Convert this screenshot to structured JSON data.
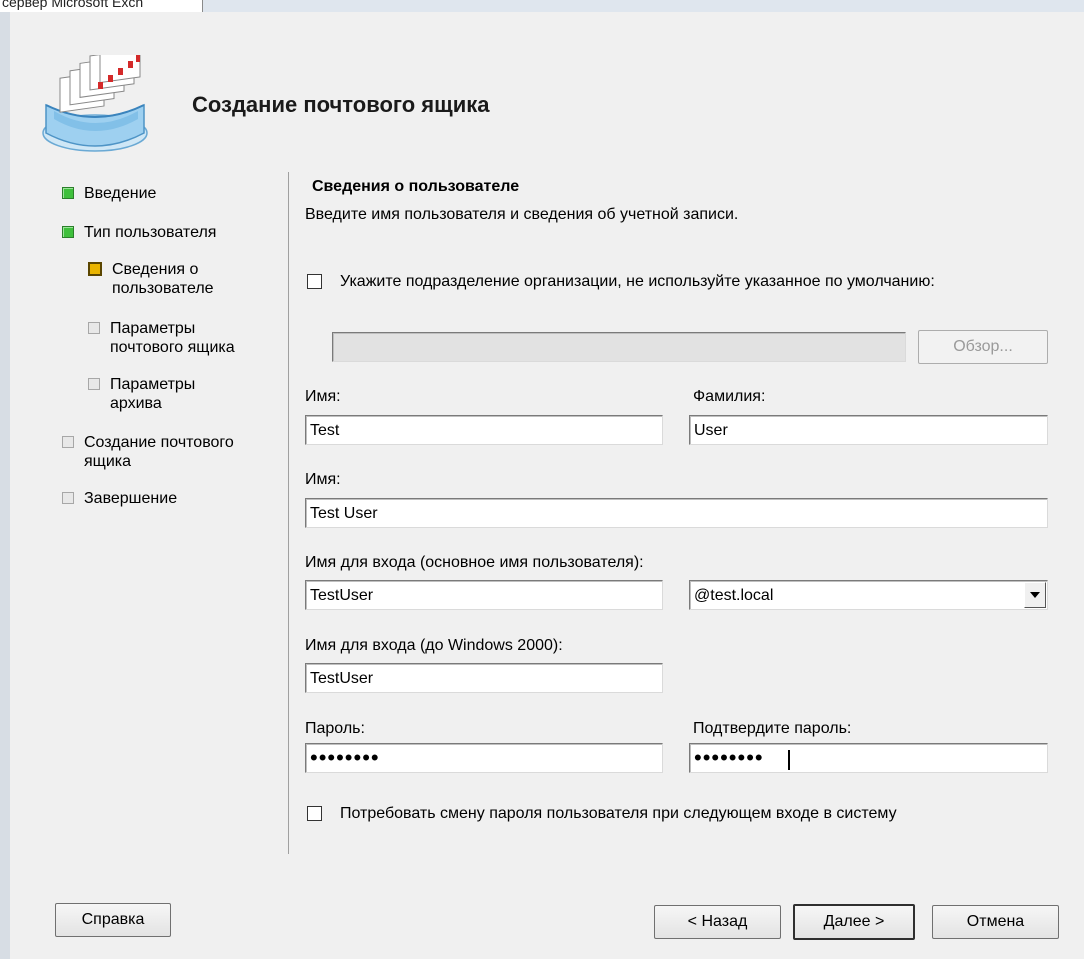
{
  "background": {
    "title_fragment": "сервер Microsoft Exch"
  },
  "dialog": {
    "title": "Создание почтового ящика",
    "icon": "mailbox-folders-icon",
    "nav": [
      {
        "label": "Введение",
        "status": "done"
      },
      {
        "label": "Тип пользователя",
        "status": "done"
      },
      {
        "label": "Сведения о пользователе",
        "status": "current"
      },
      {
        "label": "Параметры почтового ящика",
        "status": "pending"
      },
      {
        "label": "Параметры архива",
        "status": "pending"
      },
      {
        "label": "Создание почтового ящика",
        "status": "pending"
      },
      {
        "label": "Завершение",
        "status": "pending"
      }
    ],
    "section_title": "Сведения о пользователе",
    "section_subtitle": "Введите имя пользователя и сведения об учетной записи.",
    "ou_checkbox": {
      "label": "Укажите подразделение организации, не используйте указанное по умолчанию:",
      "checked": false
    },
    "ou_path": "",
    "browse_label": "Обзор...",
    "first_name": {
      "label": "Имя:",
      "value": "Test"
    },
    "last_name": {
      "label": "Фамилия:",
      "value": "User"
    },
    "full_name": {
      "label": "Имя:",
      "value": "Test User"
    },
    "upn": {
      "label": "Имя для входа (основное имя пользователя):",
      "value": "TestUser",
      "domain": "@test.local"
    },
    "pre2000": {
      "label": "Имя для входа (до Windows 2000):",
      "value": "TestUser"
    },
    "password": {
      "label": "Пароль:",
      "value": "••••••••"
    },
    "confirm_password": {
      "label": "Подтвердите пароль:",
      "value": "••••••••"
    },
    "change_pwd_checkbox": {
      "label": "Потребовать смену пароля пользователя при следующем входе в систему",
      "checked": false
    },
    "buttons": {
      "help": "Справка",
      "back": "< Назад",
      "next": "Далее >",
      "cancel": "Отмена"
    },
    "colors": {
      "done": "#3fc03c",
      "current": "#e9b400",
      "pending": "#e8e8e8"
    }
  }
}
